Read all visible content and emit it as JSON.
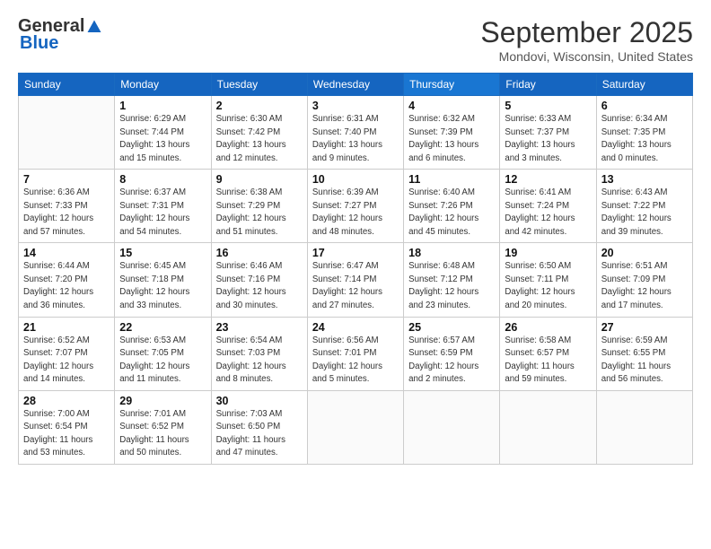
{
  "header": {
    "logo_general": "General",
    "logo_blue": "Blue",
    "month_title": "September 2025",
    "location": "Mondovi, Wisconsin, United States"
  },
  "days_of_week": [
    "Sunday",
    "Monday",
    "Tuesday",
    "Wednesday",
    "Thursday",
    "Friday",
    "Saturday"
  ],
  "weeks": [
    [
      {
        "day": "",
        "info": ""
      },
      {
        "day": "1",
        "info": "Sunrise: 6:29 AM\nSunset: 7:44 PM\nDaylight: 13 hours\nand 15 minutes."
      },
      {
        "day": "2",
        "info": "Sunrise: 6:30 AM\nSunset: 7:42 PM\nDaylight: 13 hours\nand 12 minutes."
      },
      {
        "day": "3",
        "info": "Sunrise: 6:31 AM\nSunset: 7:40 PM\nDaylight: 13 hours\nand 9 minutes."
      },
      {
        "day": "4",
        "info": "Sunrise: 6:32 AM\nSunset: 7:39 PM\nDaylight: 13 hours\nand 6 minutes."
      },
      {
        "day": "5",
        "info": "Sunrise: 6:33 AM\nSunset: 7:37 PM\nDaylight: 13 hours\nand 3 minutes."
      },
      {
        "day": "6",
        "info": "Sunrise: 6:34 AM\nSunset: 7:35 PM\nDaylight: 13 hours\nand 0 minutes."
      }
    ],
    [
      {
        "day": "7",
        "info": "Sunrise: 6:36 AM\nSunset: 7:33 PM\nDaylight: 12 hours\nand 57 minutes."
      },
      {
        "day": "8",
        "info": "Sunrise: 6:37 AM\nSunset: 7:31 PM\nDaylight: 12 hours\nand 54 minutes."
      },
      {
        "day": "9",
        "info": "Sunrise: 6:38 AM\nSunset: 7:29 PM\nDaylight: 12 hours\nand 51 minutes."
      },
      {
        "day": "10",
        "info": "Sunrise: 6:39 AM\nSunset: 7:27 PM\nDaylight: 12 hours\nand 48 minutes."
      },
      {
        "day": "11",
        "info": "Sunrise: 6:40 AM\nSunset: 7:26 PM\nDaylight: 12 hours\nand 45 minutes."
      },
      {
        "day": "12",
        "info": "Sunrise: 6:41 AM\nSunset: 7:24 PM\nDaylight: 12 hours\nand 42 minutes."
      },
      {
        "day": "13",
        "info": "Sunrise: 6:43 AM\nSunset: 7:22 PM\nDaylight: 12 hours\nand 39 minutes."
      }
    ],
    [
      {
        "day": "14",
        "info": "Sunrise: 6:44 AM\nSunset: 7:20 PM\nDaylight: 12 hours\nand 36 minutes."
      },
      {
        "day": "15",
        "info": "Sunrise: 6:45 AM\nSunset: 7:18 PM\nDaylight: 12 hours\nand 33 minutes."
      },
      {
        "day": "16",
        "info": "Sunrise: 6:46 AM\nSunset: 7:16 PM\nDaylight: 12 hours\nand 30 minutes."
      },
      {
        "day": "17",
        "info": "Sunrise: 6:47 AM\nSunset: 7:14 PM\nDaylight: 12 hours\nand 27 minutes."
      },
      {
        "day": "18",
        "info": "Sunrise: 6:48 AM\nSunset: 7:12 PM\nDaylight: 12 hours\nand 23 minutes."
      },
      {
        "day": "19",
        "info": "Sunrise: 6:50 AM\nSunset: 7:11 PM\nDaylight: 12 hours\nand 20 minutes."
      },
      {
        "day": "20",
        "info": "Sunrise: 6:51 AM\nSunset: 7:09 PM\nDaylight: 12 hours\nand 17 minutes."
      }
    ],
    [
      {
        "day": "21",
        "info": "Sunrise: 6:52 AM\nSunset: 7:07 PM\nDaylight: 12 hours\nand 14 minutes."
      },
      {
        "day": "22",
        "info": "Sunrise: 6:53 AM\nSunset: 7:05 PM\nDaylight: 12 hours\nand 11 minutes."
      },
      {
        "day": "23",
        "info": "Sunrise: 6:54 AM\nSunset: 7:03 PM\nDaylight: 12 hours\nand 8 minutes."
      },
      {
        "day": "24",
        "info": "Sunrise: 6:56 AM\nSunset: 7:01 PM\nDaylight: 12 hours\nand 5 minutes."
      },
      {
        "day": "25",
        "info": "Sunrise: 6:57 AM\nSunset: 6:59 PM\nDaylight: 12 hours\nand 2 minutes."
      },
      {
        "day": "26",
        "info": "Sunrise: 6:58 AM\nSunset: 6:57 PM\nDaylight: 11 hours\nand 59 minutes."
      },
      {
        "day": "27",
        "info": "Sunrise: 6:59 AM\nSunset: 6:55 PM\nDaylight: 11 hours\nand 56 minutes."
      }
    ],
    [
      {
        "day": "28",
        "info": "Sunrise: 7:00 AM\nSunset: 6:54 PM\nDaylight: 11 hours\nand 53 minutes."
      },
      {
        "day": "29",
        "info": "Sunrise: 7:01 AM\nSunset: 6:52 PM\nDaylight: 11 hours\nand 50 minutes."
      },
      {
        "day": "30",
        "info": "Sunrise: 7:03 AM\nSunset: 6:50 PM\nDaylight: 11 hours\nand 47 minutes."
      },
      {
        "day": "",
        "info": ""
      },
      {
        "day": "",
        "info": ""
      },
      {
        "day": "",
        "info": ""
      },
      {
        "day": "",
        "info": ""
      }
    ]
  ]
}
